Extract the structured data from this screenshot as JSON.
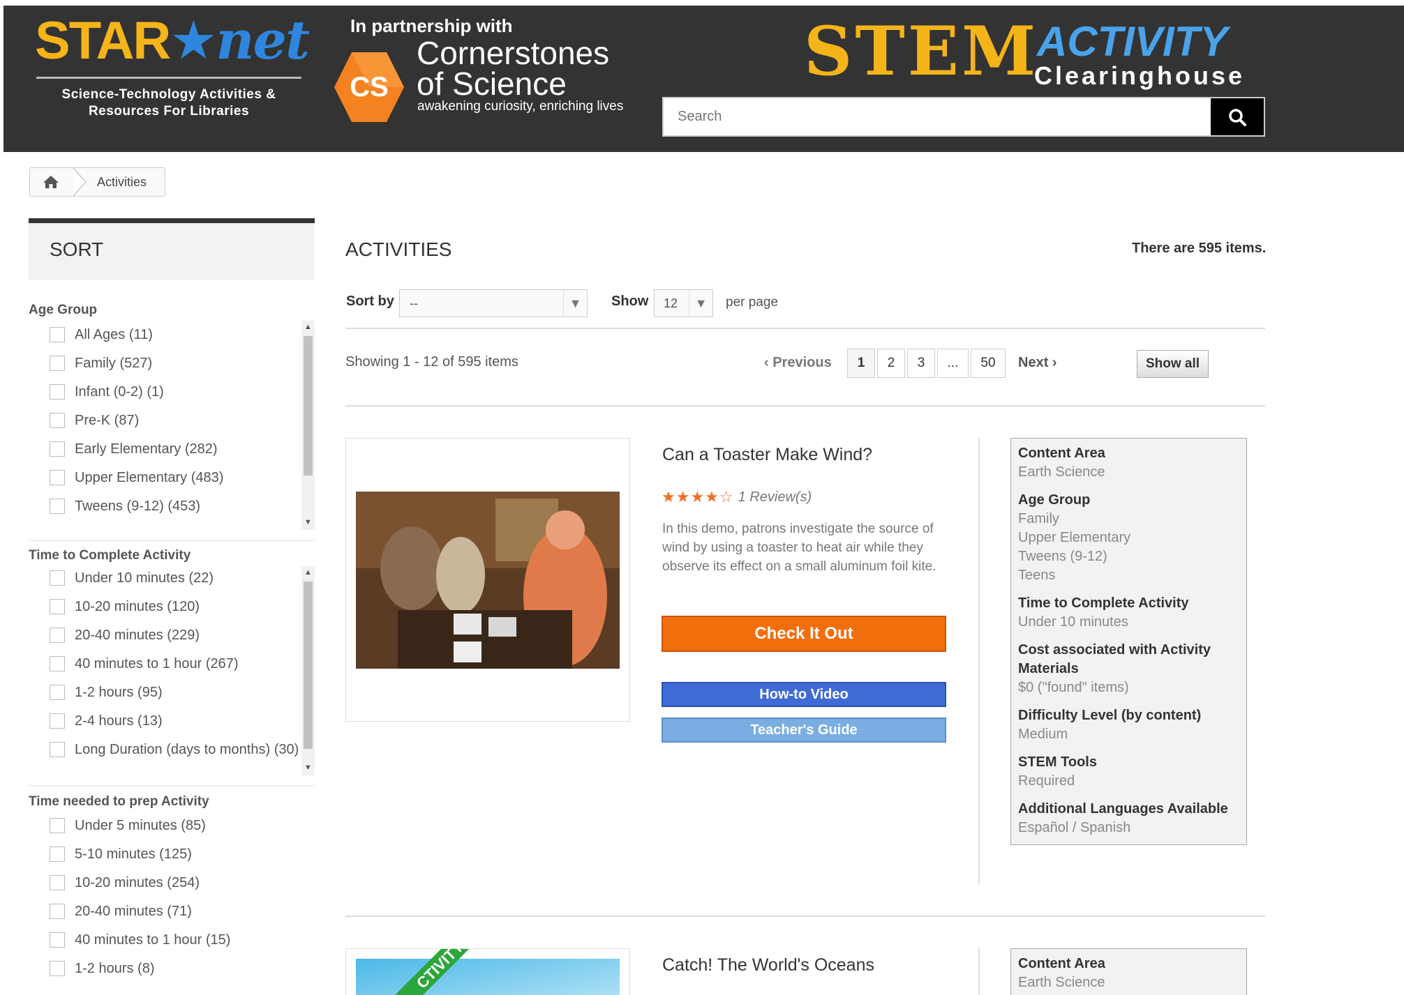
{
  "header": {
    "starnet_part1": "STAR",
    "starnet_part2": "net",
    "starnet_subtitle_1": "Science-Technology Activities &",
    "starnet_subtitle_2": "Resources For Libraries",
    "partnership": "In partnership with",
    "cs_badge": "CS",
    "cs_name_1": "Cornerstones",
    "cs_name_2": "of Science",
    "cs_tagline": "awakening curiosity, enriching lives",
    "stem": "STEM",
    "activity": "ACTIVITY",
    "clearinghouse": "Clearinghouse",
    "search_placeholder": "Search"
  },
  "breadcrumb": {
    "current": "Activities"
  },
  "sidebar": {
    "sort_title": "SORT",
    "groups": [
      {
        "title": "Age Group",
        "items": [
          "All Ages (11)",
          "Family (527)",
          "Infant (0-2) (1)",
          "Pre-K (87)",
          "Early Elementary (282)",
          "Upper Elementary (483)",
          "Tweens (9-12) (453)"
        ]
      },
      {
        "title": "Time to Complete Activity",
        "items": [
          "Under 10 minutes (22)",
          "10-20 minutes (120)",
          "20-40 minutes (229)",
          "40 minutes to 1 hour (267)",
          "1-2 hours (95)",
          "2-4 hours (13)",
          "Long Duration (days to months) (30)"
        ]
      },
      {
        "title": "Time needed to prep Activity",
        "items": [
          "Under 5 minutes (85)",
          "5-10 minutes (125)",
          "10-20 minutes (254)",
          "20-40 minutes (71)",
          "40 minutes to 1 hour (15)",
          "1-2 hours (8)"
        ]
      }
    ]
  },
  "main": {
    "heading": "ACTIVITIES",
    "count": "There are 595 items.",
    "sort_label": "Sort by",
    "sort_value": "--",
    "show_label": "Show",
    "show_value": "12",
    "per_page": "per page",
    "showing": "Showing 1 - 12 of 595 items",
    "previous": "Previous",
    "next": "Next",
    "pages": [
      "1",
      "2",
      "3",
      "...",
      "50"
    ],
    "show_all": "Show all"
  },
  "activities": [
    {
      "title": "Can a Toaster Make Wind?",
      "rating": 4,
      "reviews": "1 Review(s)",
      "description_lines": [
        "In this demo, patrons investigate the source of",
        "wind by using a toaster to heat air while they",
        "observe its effect on a small aluminum foil kite."
      ],
      "check_label": "Check It Out",
      "video_label": "How-to Video",
      "guide_label": "Teacher's Guide",
      "meta": {
        "content_area_label": "Content Area",
        "content_area": "Earth Science",
        "age_group_label": "Age Group",
        "age_groups": [
          "Family",
          "Upper Elementary",
          "Tweens (9-12)",
          "Teens"
        ],
        "time_label": "Time to Complete Activity",
        "time": "Under 10 minutes",
        "cost_label_1": "Cost associated with Activity",
        "cost_label_2": "Materials",
        "cost": "$0 (\"found\" items)",
        "difficulty_label": "Difficulty Level (by content)",
        "difficulty": "Medium",
        "tools_label": "STEM Tools",
        "tools": "Required",
        "languages_label": "Additional Languages Available",
        "languages": "Español / Spanish"
      }
    },
    {
      "title": "Catch! The World's Oceans",
      "ribbon": "CTIVITY",
      "meta": {
        "content_area_label": "Content Area",
        "content_area": "Earth Science"
      }
    }
  ],
  "colors": {
    "header_bg": "#333333",
    "brand_yellow": "#f4b41a",
    "brand_blue": "#2e86de",
    "check_orange": "#f26e0d",
    "video_blue": "#3f6bd6",
    "guide_blue": "#7aaee3",
    "star_orange": "#f26e24"
  },
  "icons": [
    "search-icon",
    "home-icon",
    "chevron-left-icon",
    "chevron-right-icon",
    "star-icon",
    "caret-down-icon"
  ]
}
